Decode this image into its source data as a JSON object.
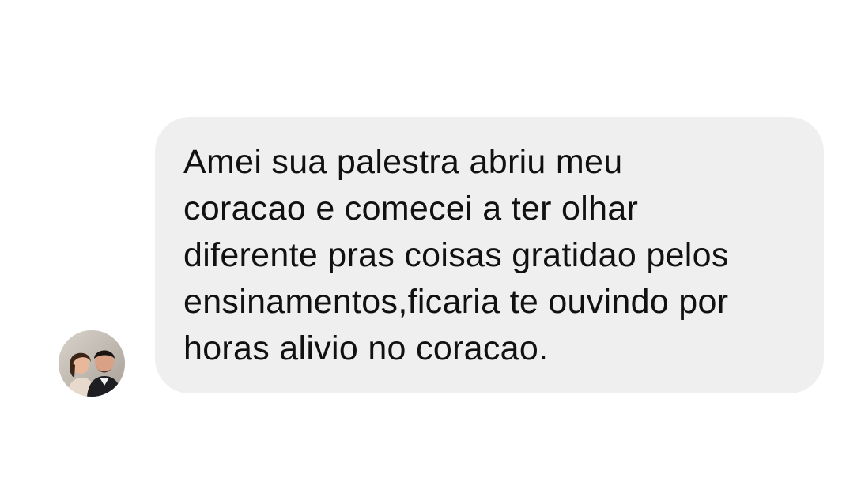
{
  "conversation": {
    "messages": [
      {
        "direction": "incoming",
        "text": "Amei sua palestra abriu meu\ncoracao e comecei a ter olhar\ndiferente pras coisas gratidao pelos\nensinamentos,ficaria te ouvindo por\nhoras alivio no coracao.",
        "avatar_icon": "profile-photo-couple"
      }
    ]
  },
  "colors": {
    "background": "#ffffff",
    "bubble": "#efefef",
    "text": "#111111"
  }
}
